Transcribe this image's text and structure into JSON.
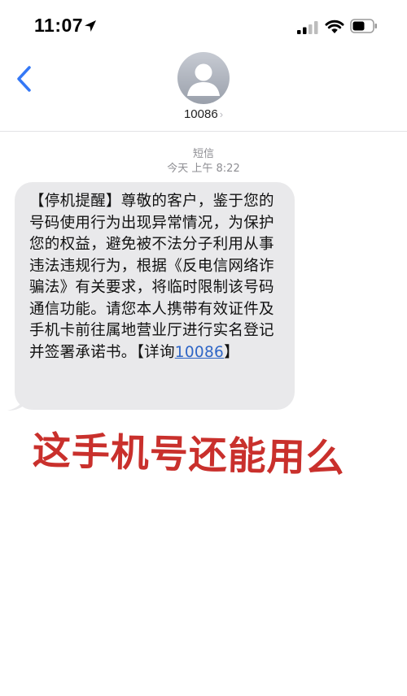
{
  "status_bar": {
    "time": "11:07",
    "icons": [
      "location-arrow-icon",
      "signal-icon",
      "wifi-icon",
      "battery-icon"
    ]
  },
  "header": {
    "back_icon": "chevron-left-icon",
    "contact": "10086",
    "chevron": "›"
  },
  "thread": {
    "message_type": "短信",
    "timestamp": "今天 上午 8:22",
    "message": {
      "text": "【停机提醒】尊敬的客户，鉴于您的号码使用行为出现异常情况，为保护您的权益，避免被不法分子利用从事违法违规行为，根据《反电信网络诈骗法》有关要求，将临时限制该号码通信功能。请您本人携带有效证件及手机卡前往属地营业厅进行实名登记并签署承诺书。【详询",
      "link": "10086",
      "trailing": "】"
    }
  },
  "annotation": {
    "text": "这手机号还能用么"
  },
  "colors": {
    "accent": "#3478f6",
    "bubble": "#e9e9eb",
    "link": "#2f66c6",
    "annotation": "#c9302c"
  }
}
